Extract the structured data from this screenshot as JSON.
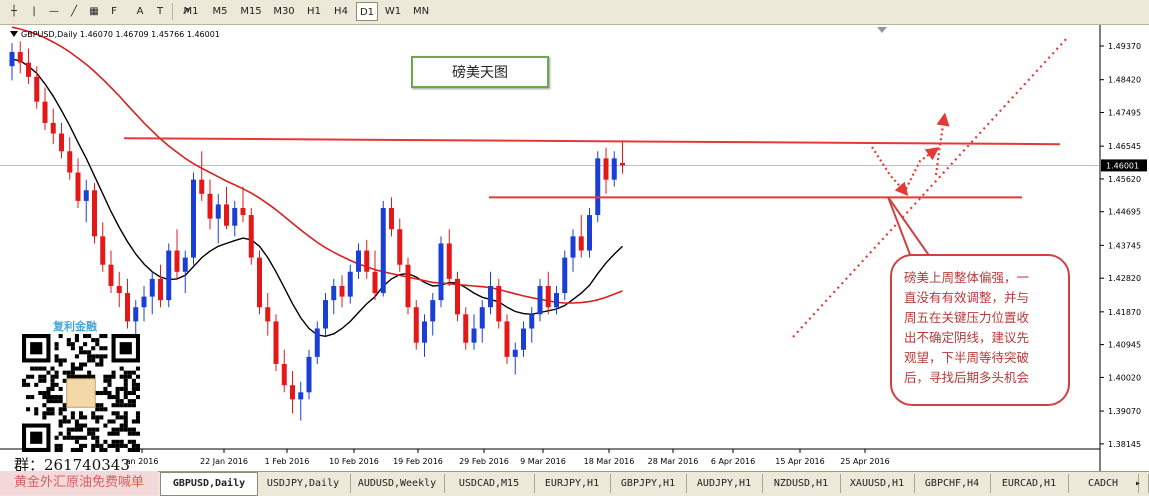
{
  "toolbar": {
    "tools": [
      {
        "name": "crosshair-icon",
        "glyph": "┼"
      },
      {
        "name": "vertical-line-icon",
        "glyph": "|"
      },
      {
        "name": "horizontal-line-icon",
        "glyph": "—"
      },
      {
        "name": "trendline-icon",
        "glyph": "╱"
      },
      {
        "name": "channel-icon",
        "glyph": "▦"
      },
      {
        "name": "fibonacci-icon",
        "glyph": "F"
      },
      {
        "name": "text-icon",
        "glyph": "A"
      },
      {
        "name": "text-label-icon",
        "glyph": "T"
      },
      {
        "name": "arrows-icon",
        "glyph": "↗"
      }
    ],
    "periods": [
      "M1",
      "M5",
      "M15",
      "M30",
      "H1",
      "H4",
      "D1",
      "W1",
      "MN"
    ],
    "active_period": "D1"
  },
  "chart": {
    "header": "GBPUSD,Daily  1.46070 1.46709 1.45766 1.46001",
    "title_box": "磅美天图",
    "current_price": "1.46001",
    "y_ticks": [
      "1.49370",
      "1.48420",
      "1.47495",
      "1.46545",
      "1.45620",
      "1.44695",
      "1.43745",
      "1.42820",
      "1.41870",
      "1.40945",
      "1.40020",
      "1.39070",
      "1.38145"
    ],
    "x_ticks": [
      "an 2016",
      "22 Jan 2016",
      "1 Feb 2016",
      "10 Feb 2016",
      "19 Feb 2016",
      "29 Feb 2016",
      "9 Mar 2016",
      "18 Mar 2016",
      "28 Mar 2016",
      "6 Apr 2016",
      "15 Apr 2016",
      "25 Apr 2016"
    ],
    "callout": [
      "磅美上周整体偏强，一",
      "直没有有效调整，并与",
      "周五在关键压力位置收",
      "出不确定阴线，建议先",
      "观望，下半周等待突破",
      "后，寻找后期多头机会"
    ],
    "colors": {
      "bull": "#1a3fd6",
      "bear": "#e41818",
      "ma_fast": "#000000",
      "ma_slow": "#d92020",
      "lines": "#e53935"
    }
  },
  "watermark": {
    "brand": "复利金融",
    "qq": "群：261740343",
    "promo": "黄金外汇原油免费喊单"
  },
  "tabs": [
    "GBPUSD,Daily",
    "USDJPY,Daily",
    "AUDUSD,Weekly",
    "USDCAD,M15",
    "EURJPY,H1",
    "GBPJPY,H1",
    "AUDJPY,H1",
    "NZDUSD,H1",
    "XAUUSD,H1",
    "GBPCHF,H4",
    "EURCAD,H1",
    "CADCH"
  ],
  "active_tab": "GBPUSD,Daily",
  "chart_data": {
    "type": "candlestick",
    "series": [
      {
        "name": "candles",
        "ohlc": [
          [
            1.488,
            1.4945,
            1.484,
            1.492
          ],
          [
            1.492,
            1.495,
            1.486,
            1.489
          ],
          [
            1.489,
            1.493,
            1.483,
            1.485
          ],
          [
            1.485,
            1.488,
            1.476,
            1.478
          ],
          [
            1.478,
            1.482,
            1.47,
            1.472
          ],
          [
            1.472,
            1.476,
            1.466,
            1.469
          ],
          [
            1.469,
            1.472,
            1.462,
            1.464
          ],
          [
            1.464,
            1.468,
            1.456,
            1.458
          ],
          [
            1.458,
            1.462,
            1.448,
            1.45
          ],
          [
            1.45,
            1.456,
            1.444,
            1.453
          ],
          [
            1.453,
            1.455,
            1.438,
            1.44
          ],
          [
            1.44,
            1.444,
            1.43,
            1.432
          ],
          [
            1.432,
            1.436,
            1.424,
            1.426
          ],
          [
            1.426,
            1.43,
            1.42,
            1.424
          ],
          [
            1.424,
            1.428,
            1.414,
            1.416
          ],
          [
            1.416,
            1.422,
            1.41,
            1.42
          ],
          [
            1.42,
            1.426,
            1.416,
            1.423
          ],
          [
            1.423,
            1.43,
            1.418,
            1.428
          ],
          [
            1.428,
            1.432,
            1.42,
            1.422
          ],
          [
            1.422,
            1.438,
            1.42,
            1.436
          ],
          [
            1.436,
            1.442,
            1.428,
            1.43
          ],
          [
            1.43,
            1.436,
            1.424,
            1.434
          ],
          [
            1.434,
            1.458,
            1.432,
            1.456
          ],
          [
            1.456,
            1.464,
            1.45,
            1.452
          ],
          [
            1.452,
            1.456,
            1.442,
            1.445
          ],
          [
            1.445,
            1.452,
            1.438,
            1.449
          ],
          [
            1.449,
            1.454,
            1.442,
            1.443
          ],
          [
            1.443,
            1.45,
            1.44,
            1.448
          ],
          [
            1.448,
            1.454,
            1.444,
            1.446
          ],
          [
            1.446,
            1.448,
            1.432,
            1.434
          ],
          [
            1.434,
            1.436,
            1.418,
            1.42
          ],
          [
            1.42,
            1.424,
            1.412,
            1.416
          ],
          [
            1.416,
            1.418,
            1.402,
            1.404
          ],
          [
            1.404,
            1.408,
            1.396,
            1.398
          ],
          [
            1.398,
            1.402,
            1.39,
            1.394
          ],
          [
            1.394,
            1.399,
            1.388,
            1.396
          ],
          [
            1.396,
            1.408,
            1.394,
            1.406
          ],
          [
            1.406,
            1.416,
            1.404,
            1.414
          ],
          [
            1.414,
            1.424,
            1.412,
            1.422
          ],
          [
            1.422,
            1.428,
            1.418,
            1.426
          ],
          [
            1.426,
            1.429,
            1.42,
            1.423
          ],
          [
            1.423,
            1.432,
            1.421,
            1.43
          ],
          [
            1.43,
            1.438,
            1.428,
            1.436
          ],
          [
            1.436,
            1.439,
            1.428,
            1.43
          ],
          [
            1.43,
            1.436,
            1.422,
            1.424
          ],
          [
            1.424,
            1.45,
            1.423,
            1.448
          ],
          [
            1.448,
            1.451,
            1.44,
            1.442
          ],
          [
            1.442,
            1.445,
            1.43,
            1.432
          ],
          [
            1.432,
            1.434,
            1.418,
            1.42
          ],
          [
            1.42,
            1.422,
            1.408,
            1.41
          ],
          [
            1.41,
            1.418,
            1.406,
            1.416
          ],
          [
            1.416,
            1.424,
            1.412,
            1.422
          ],
          [
            1.422,
            1.44,
            1.42,
            1.438
          ],
          [
            1.438,
            1.442,
            1.426,
            1.428
          ],
          [
            1.428,
            1.43,
            1.416,
            1.418
          ],
          [
            1.418,
            1.42,
            1.408,
            1.41
          ],
          [
            1.41,
            1.418,
            1.408,
            1.414
          ],
          [
            1.414,
            1.422,
            1.41,
            1.42
          ],
          [
            1.42,
            1.43,
            1.418,
            1.426
          ],
          [
            1.426,
            1.428,
            1.414,
            1.416
          ],
          [
            1.416,
            1.418,
            1.404,
            1.406
          ],
          [
            1.406,
            1.41,
            1.401,
            1.408
          ],
          [
            1.408,
            1.416,
            1.406,
            1.414
          ],
          [
            1.414,
            1.42,
            1.41,
            1.418
          ],
          [
            1.418,
            1.428,
            1.416,
            1.426
          ],
          [
            1.426,
            1.43,
            1.418,
            1.42
          ],
          [
            1.42,
            1.426,
            1.418,
            1.424
          ],
          [
            1.424,
            1.436,
            1.422,
            1.434
          ],
          [
            1.434,
            1.442,
            1.43,
            1.44
          ],
          [
            1.44,
            1.446,
            1.434,
            1.436
          ],
          [
            1.436,
            1.448,
            1.434,
            1.446
          ],
          [
            1.446,
            1.464,
            1.444,
            1.462
          ],
          [
            1.462,
            1.465,
            1.452,
            1.456
          ],
          [
            1.456,
            1.464,
            1.454,
            1.462
          ],
          [
            1.4607,
            1.4671,
            1.4577,
            1.46
          ]
        ]
      },
      {
        "name": "ma_fast",
        "values": [
          1.49,
          1.4895,
          1.488,
          1.486,
          1.483,
          1.4795,
          1.4755,
          1.4712,
          1.4665,
          1.462,
          1.457,
          1.452,
          1.447,
          1.4425,
          1.4385,
          1.435,
          1.4322,
          1.43,
          1.4285,
          1.4278,
          1.428,
          1.429,
          1.4315,
          1.434,
          1.4358,
          1.4372,
          1.438,
          1.4388,
          1.4395,
          1.439,
          1.4372,
          1.434,
          1.43,
          1.4255,
          1.421,
          1.417,
          1.414,
          1.4122,
          1.4118,
          1.4125,
          1.414,
          1.416,
          1.4185,
          1.421,
          1.423,
          1.426,
          1.428,
          1.4292,
          1.4295,
          1.4285,
          1.427,
          1.426,
          1.4262,
          1.427,
          1.4268,
          1.4255,
          1.424,
          1.4228,
          1.4222,
          1.4215,
          1.42,
          1.4188,
          1.4182,
          1.418,
          1.4185,
          1.419,
          1.4195,
          1.4205,
          1.4222,
          1.424,
          1.4262,
          1.4295,
          1.4325,
          1.435,
          1.4372
        ]
      },
      {
        "name": "ma_slow",
        "values": [
          1.499,
          1.4985,
          1.4978,
          1.497,
          1.496,
          1.4948,
          1.4935,
          1.492,
          1.4903,
          1.4885,
          1.4865,
          1.4843,
          1.482,
          1.4796,
          1.477,
          1.4745,
          1.472,
          1.4697,
          1.4675,
          1.4655,
          1.4637,
          1.462,
          1.4605,
          1.4592,
          1.458,
          1.4568,
          1.4556,
          1.4545,
          1.4534,
          1.4522,
          1.4508,
          1.4492,
          1.4475,
          1.4456,
          1.4437,
          1.4418,
          1.44,
          1.4383,
          1.4368,
          1.4355,
          1.4343,
          1.4332,
          1.4322,
          1.4314,
          1.4306,
          1.43,
          1.4295,
          1.429,
          1.4285,
          1.428,
          1.4275,
          1.427,
          1.4268,
          1.4266,
          1.4264,
          1.4262,
          1.426,
          1.4258,
          1.4255,
          1.425,
          1.4244,
          1.4238,
          1.4232,
          1.4227,
          1.4222,
          1.4218,
          1.4214,
          1.4212,
          1.4212,
          1.4213,
          1.4216,
          1.4221,
          1.4228,
          1.4237,
          1.4246
        ]
      }
    ],
    "resistance_upper": 1.466,
    "resistance_lower": 1.451,
    "ylim": [
      1.38,
      1.4985
    ]
  }
}
